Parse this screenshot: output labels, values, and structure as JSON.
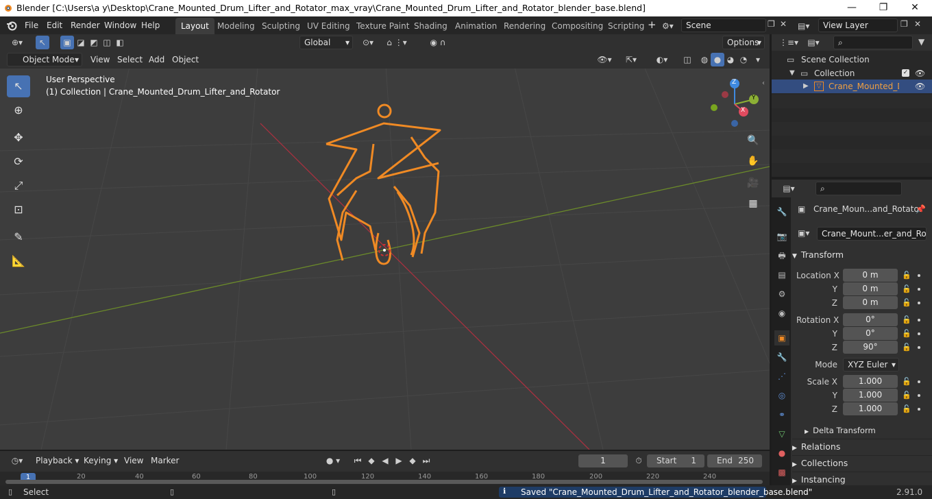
{
  "window": {
    "title": "Blender [C:\\Users\\a y\\Desktop\\Crane_Mounted_Drum_Lifter_and_Rotator_max_vray\\Crane_Mounted_Drum_Lifter_and_Rotator_blender_base.blend]",
    "minimize": "—",
    "maximize": "❐",
    "close": "✕"
  },
  "menu": {
    "items": [
      "File",
      "Edit",
      "Render",
      "Window",
      "Help"
    ]
  },
  "workspaces": {
    "tabs": [
      "Layout",
      "Modeling",
      "Sculpting",
      "UV Editing",
      "Texture Paint",
      "Shading",
      "Animation",
      "Rendering",
      "Compositing",
      "Scripting"
    ],
    "active": "Layout",
    "add": "+"
  },
  "scene": {
    "label": "Scene"
  },
  "view_layer": {
    "label": "View Layer"
  },
  "viewport": {
    "transform_orientation": "Global",
    "options": "Options",
    "mode": "Object Mode",
    "menus": [
      "View",
      "Select",
      "Add",
      "Object"
    ],
    "overlay_title": "User Perspective",
    "overlay_subtitle": "(1) Collection | Crane_Mounted_Drum_Lifter_and_Rotator",
    "gizmo": {
      "x": "X",
      "y": "Y",
      "z": "Z"
    }
  },
  "outliner": {
    "scene_collection": "Scene Collection",
    "collection": "Collection",
    "object": "Crane_Mounted_Drum_Lifter_and_Rotator"
  },
  "properties": {
    "object_name": "Crane_Moun...and_Rotator",
    "data_name": "Crane_Mount...er_and_Rotator",
    "transform_header": "Transform",
    "location": {
      "label": "Location X",
      "y_label": "Y",
      "z_label": "Z",
      "x": "0 m",
      "y": "0 m",
      "z": "0 m"
    },
    "rotation": {
      "label": "Rotation X",
      "y_label": "Y",
      "z_label": "Z",
      "x": "0°",
      "y": "0°",
      "z": "90°"
    },
    "mode_label": "Mode",
    "mode_value": "XYZ Euler",
    "scale": {
      "label": "Scale X",
      "y_label": "Y",
      "z_label": "Z",
      "x": "1.000",
      "y": "1.000",
      "z": "1.000"
    },
    "delta_transform": "Delta Transform",
    "sections": [
      "Relations",
      "Collections",
      "Instancing"
    ]
  },
  "timeline": {
    "menus": [
      "Playback",
      "Keying",
      "View",
      "Marker"
    ],
    "current_frame": "1",
    "start_label": "Start",
    "start": "1",
    "end_label": "End",
    "end": "250",
    "ruler_labels": [
      "1",
      "20",
      "40",
      "60",
      "80",
      "100",
      "120",
      "140",
      "160",
      "180",
      "200",
      "220",
      "240"
    ]
  },
  "status": {
    "left": "Select",
    "message": "Saved \"Crane_Mounted_Drum_Lifter_and_Rotator_blender_base.blend\"",
    "version": "2.91.0"
  },
  "colors": {
    "accent": "#4772b3",
    "selection_outline": "#f08a24",
    "axis_x": "#e04b5f",
    "axis_y": "#8cb035",
    "axis_z": "#3f8ae0"
  }
}
